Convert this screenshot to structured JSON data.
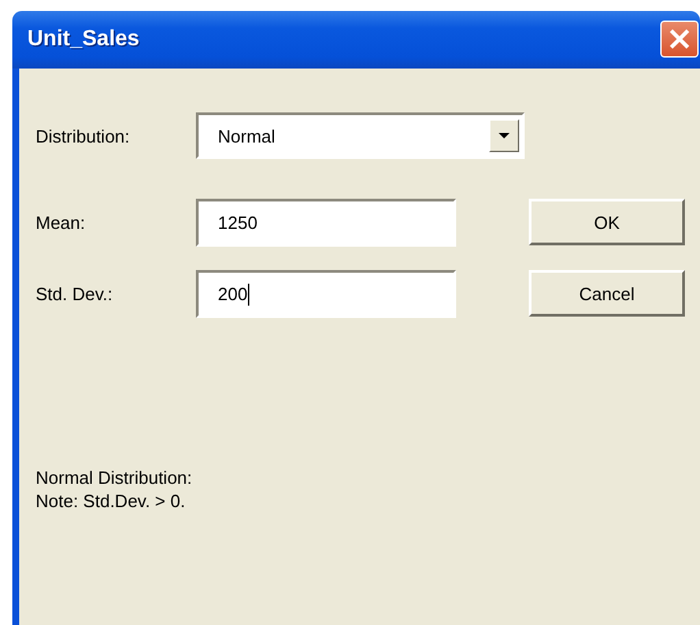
{
  "window": {
    "title": "Unit_Sales",
    "close": "×"
  },
  "distribution": {
    "label": "Distribution:",
    "value": "Normal"
  },
  "fields": [
    {
      "label": "Mean:",
      "value": "1250",
      "focused": false
    },
    {
      "label": "Std. Dev.:",
      "value": "200",
      "focused": true
    }
  ],
  "buttons": [
    "OK",
    "Cancel"
  ],
  "note_lines": [
    "Normal Distribution:",
    "Note: Std.Dev. > 0."
  ]
}
